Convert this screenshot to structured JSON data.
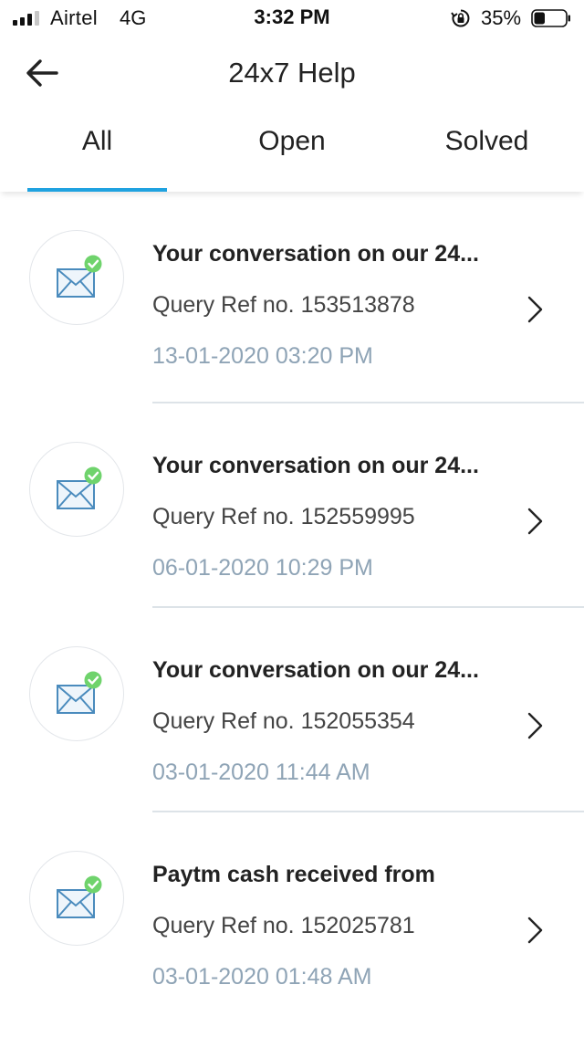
{
  "status_bar": {
    "carrier": "Airtel",
    "network": "4G",
    "time": "3:32 PM",
    "battery_percent": "35%",
    "battery_level": 0.35,
    "signal_bars": 3,
    "icons": [
      "signal-icon",
      "rotation-lock-icon",
      "battery-icon"
    ]
  },
  "header": {
    "title": "24x7 Help",
    "back_icon": "back-arrow-icon"
  },
  "tabs": [
    {
      "label": "All",
      "active": true
    },
    {
      "label": "Open",
      "active": false
    },
    {
      "label": "Solved",
      "active": false
    }
  ],
  "colors": {
    "accent": "#1fa2e0",
    "date_text": "#8fa4b6",
    "check_green": "#6fd36c",
    "envelope": "#4a8bbd"
  },
  "queries": [
    {
      "title": "Your conversation on our 24...",
      "ref": "Query Ref no. 153513878",
      "date": "13-01-2020 03:20 PM",
      "icon": "mail-check-icon"
    },
    {
      "title": "Your conversation on our 24...",
      "ref": "Query Ref no. 152559995",
      "date": "06-01-2020 10:29 PM",
      "icon": "mail-check-icon"
    },
    {
      "title": "Your conversation on our 24...",
      "ref": "Query Ref no. 152055354",
      "date": "03-01-2020 11:44 AM",
      "icon": "mail-check-icon"
    },
    {
      "title": "Paytm cash received from",
      "ref": "Query Ref no. 152025781",
      "date": "03-01-2020 01:48 AM",
      "icon": "mail-check-icon"
    }
  ]
}
